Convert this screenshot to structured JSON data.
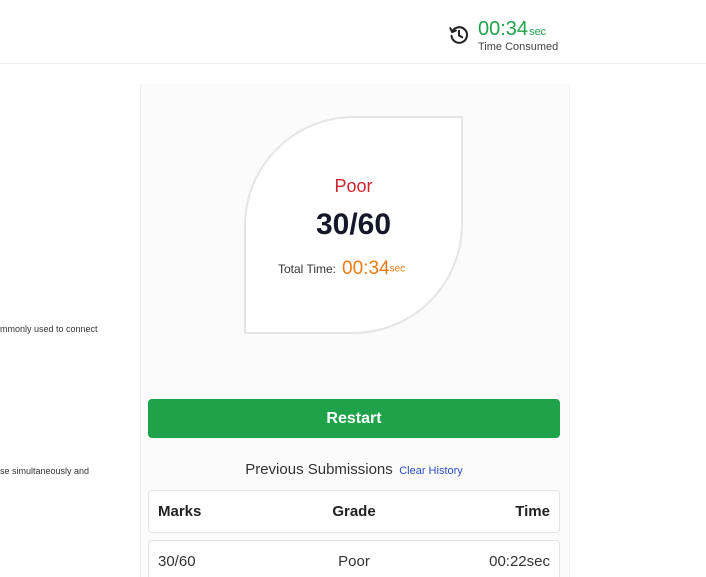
{
  "header": {
    "timer_value": "00:34",
    "timer_unit": "sec",
    "timer_label": "Time Consumed",
    "accent_color": "#1ea34a"
  },
  "left_fragments": [
    "mmonly used to connect",
    "se simultaneously and"
  ],
  "result": {
    "grade": "Poor",
    "score": "30/60",
    "total_time_label": "Total Time:",
    "total_time_value": "00:34",
    "total_time_unit": "sec",
    "grade_color": "#d1242f",
    "time_color": "#f07a12"
  },
  "actions": {
    "restart_label": "Restart"
  },
  "previous_submissions": {
    "title": "Previous Submissions",
    "clear_label": "Clear History",
    "columns": [
      "Marks",
      "Grade",
      "Time"
    ],
    "rows": [
      {
        "marks": "30/60",
        "grade": "Poor",
        "time": "00:22sec"
      }
    ]
  },
  "icons": {
    "timer": "history-icon"
  }
}
